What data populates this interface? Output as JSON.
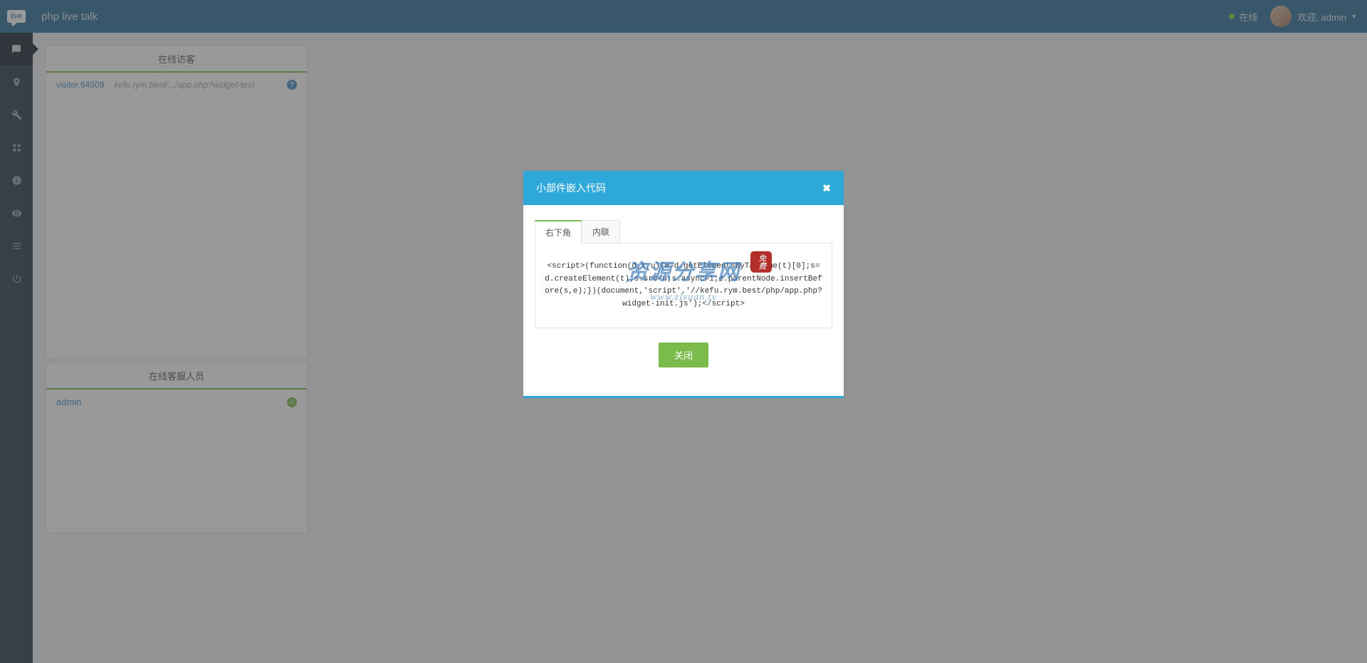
{
  "header": {
    "logo_text": "live",
    "title": "php live talk",
    "status_label": "在线",
    "welcome_prefix": "欢迎,",
    "username": "admin"
  },
  "sidebar": {
    "items": [
      {
        "name": "chat-icon",
        "active": true
      },
      {
        "name": "location-icon",
        "active": false
      },
      {
        "name": "wrench-icon",
        "active": false
      },
      {
        "name": "grid-icon",
        "active": false
      },
      {
        "name": "info-icon",
        "active": false
      },
      {
        "name": "eye-icon",
        "active": false
      },
      {
        "name": "list-icon",
        "active": false
      },
      {
        "name": "power-icon",
        "active": false
      }
    ]
  },
  "visitors": {
    "panel_title": "在线访客",
    "list": [
      {
        "id": "visitor.64509",
        "path": "kefu.rym.best/.../app.php?widget-test"
      }
    ]
  },
  "agents": {
    "panel_title": "在线客服人员",
    "list": [
      {
        "name": "admin"
      }
    ]
  },
  "modal": {
    "title": "小部件嵌入代码",
    "tabs": [
      {
        "label": "右下角",
        "active": true
      },
      {
        "label": "内联",
        "active": false
      }
    ],
    "code": "<script>(function(d,t,u){e=d.getElementsByTagName(t)[0];s=d.createElement(t);s.src=u;s.async=1;e.parentNode.insertBefore(s,e);})(document,'script','//kefu.rym.best/php/app.php?widget-init.js');</script>",
    "close_button": "关闭",
    "watermark_main": "资源分享网",
    "watermark_sub": "www.ziyuan.tv",
    "watermark_seal": "免费"
  }
}
